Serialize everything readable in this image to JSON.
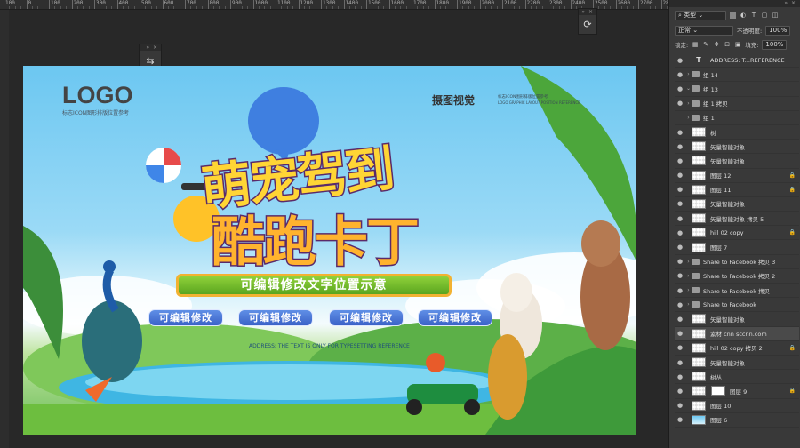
{
  "ruler": {
    "labels": [
      "100",
      "0",
      "100",
      "200",
      "300",
      "400",
      "500",
      "600",
      "700",
      "800",
      "900",
      "1000",
      "1100",
      "1200",
      "1300",
      "1400",
      "1500",
      "1600",
      "1700",
      "1800",
      "1900",
      "2000",
      "2100",
      "2200",
      "2300",
      "2400",
      "2500",
      "2600",
      "2700",
      "2800",
      "2900",
      "3000"
    ]
  },
  "floating": {
    "panel1_head": "» ×",
    "panel1_icon": "⇆",
    "panel2_head": "» ×",
    "panel2_icon": "⟳"
  },
  "artwork": {
    "logo": "LOGO",
    "logo_sub": "标志ICON图形排版位置参考",
    "brand": "摄图视觉",
    "brand_sub1": "标志ICON图形排版位置参考",
    "brand_sub2": "LOGO GRAPHIC LAYOUT POSITION REFERENCE",
    "title_line1": "萌宠驾到",
    "title_line2": "酷跑卡丁",
    "subtitle": "可编辑修改文字位置示意",
    "buttons": [
      "可编辑修改",
      "可编辑修改",
      "可编辑修改",
      "可编辑修改"
    ],
    "note": "ADDRESS: THE TEXT IS ONLY FOR TYPESETTING REFERENCE"
  },
  "panel": {
    "head": "» ×",
    "filter_label": "类型",
    "blend_mode": "正常",
    "opacity_label": "不透明度:",
    "opacity_value": "100%",
    "lock_label": "锁定:",
    "fill_label": "填充:",
    "fill_value": "100%"
  },
  "layers": [
    {
      "name": "ADDRESS: T...REFERENCE",
      "kind": "text",
      "visible": true
    },
    {
      "name": "组 14",
      "kind": "group",
      "visible": true
    },
    {
      "name": "组 13",
      "kind": "group-open",
      "visible": true
    },
    {
      "name": "组 1 拷贝",
      "kind": "group",
      "visible": true
    },
    {
      "name": "组 1",
      "kind": "group",
      "visible": false
    },
    {
      "name": "树",
      "kind": "layer",
      "visible": true
    },
    {
      "name": "矢量智能对象",
      "kind": "layer",
      "visible": true
    },
    {
      "name": "矢量智能对象",
      "kind": "layer",
      "visible": true
    },
    {
      "name": "图层 12",
      "kind": "layer",
      "visible": true,
      "locked": true
    },
    {
      "name": "图层 11",
      "kind": "layer",
      "visible": true,
      "locked": true
    },
    {
      "name": "矢量智能对象",
      "kind": "layer",
      "visible": true
    },
    {
      "name": "矢量智能对象 拷贝 5",
      "kind": "layer",
      "visible": true
    },
    {
      "name": "hill 02 copy",
      "kind": "layer",
      "visible": true,
      "locked": true
    },
    {
      "name": "图层 7",
      "kind": "layer",
      "visible": true
    },
    {
      "name": "Share to Facebook 拷贝 3",
      "kind": "group",
      "visible": true
    },
    {
      "name": "Share to Facebook 拷贝 2",
      "kind": "group",
      "visible": true
    },
    {
      "name": "Share to Facebook 拷贝",
      "kind": "group",
      "visible": true
    },
    {
      "name": "Share to Facebook",
      "kind": "group",
      "visible": true
    },
    {
      "name": "矢量智能对象",
      "kind": "layer",
      "visible": true
    },
    {
      "name": "素材 cnn sccnn.com",
      "kind": "layer",
      "visible": true,
      "selected": true
    },
    {
      "name": "hill 02 copy 拷贝 2",
      "kind": "layer",
      "visible": true,
      "locked": true
    },
    {
      "name": "矢量智能对象",
      "kind": "layer",
      "visible": true
    },
    {
      "name": "树丛",
      "kind": "layer",
      "visible": true
    },
    {
      "name": "图层 9",
      "kind": "masked",
      "visible": true,
      "locked": true
    },
    {
      "name": "图层 10",
      "kind": "layer",
      "visible": true
    },
    {
      "name": "图层 6",
      "kind": "sky",
      "visible": true
    }
  ],
  "icons": {
    "eye": "●",
    "lock": "🔒",
    "chevron-right": "›",
    "chevron-down": "⌄"
  },
  "colors": {
    "accent": "#3b62c7",
    "title_fill": "#ffd535",
    "subtitle_green": "#6db52a",
    "panel_bg": "#393939"
  }
}
